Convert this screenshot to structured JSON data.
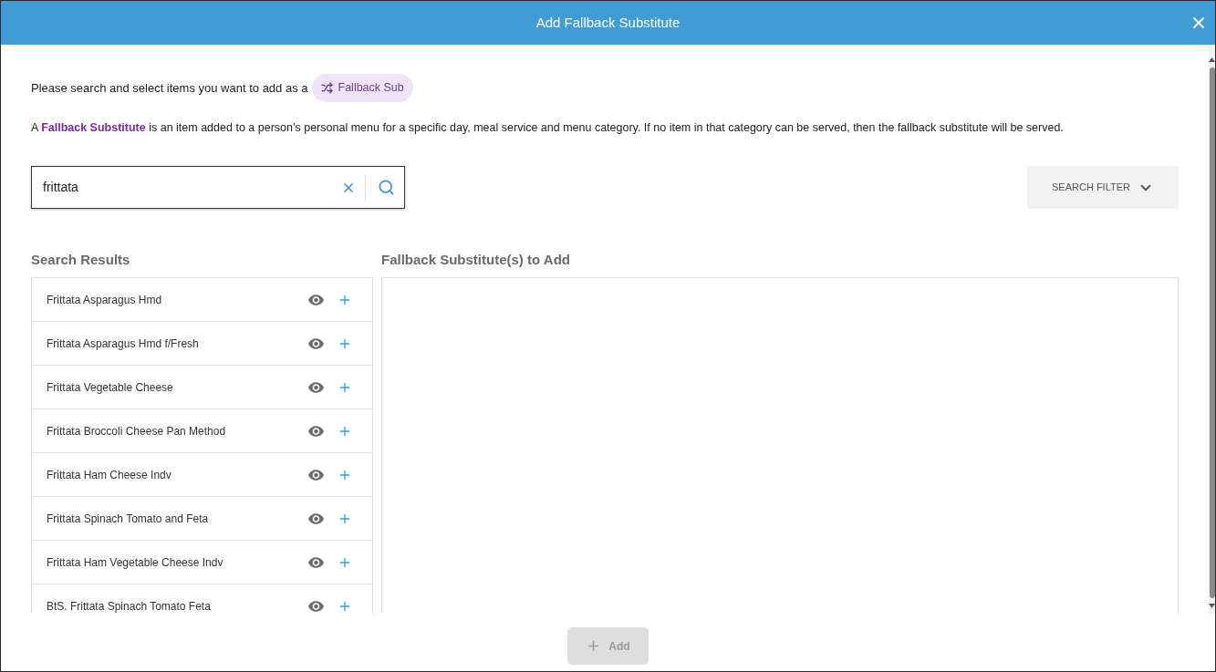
{
  "dialog": {
    "title": "Add Fallback Substitute"
  },
  "intro": {
    "text": "Please search and select items you want to add as a",
    "badge": "Fallback Sub"
  },
  "description": "A **Fallback Substitute** is an item added to a person’s personal menu for a specific day, meal service and menu category. If no item in that category can be served, then the fallback substitute will be served.",
  "search": {
    "value": "frittata"
  },
  "filter_button": {
    "label": "SEARCH FILTER"
  },
  "search_results": {
    "heading": "Search Results",
    "items": [
      {
        "name": "Frittata Asparagus Hmd"
      },
      {
        "name": "Frittata Asparagus Hmd f/Fresh"
      },
      {
        "name": "Frittata Vegetable Cheese"
      },
      {
        "name": "Frittata Broccoli Cheese Pan Method"
      },
      {
        "name": "Frittata Ham Cheese Indv"
      },
      {
        "name": "Frittata Spinach Tomato and Feta"
      },
      {
        "name": "Frittata Ham Vegetable Cheese Indv"
      },
      {
        "name": "BtS. Frittata Spinach Tomato Feta"
      }
    ]
  },
  "to_add": {
    "heading": "Fallback Substitute(s) to Add"
  },
  "add_button": {
    "label": "Add",
    "disabled": true
  }
}
